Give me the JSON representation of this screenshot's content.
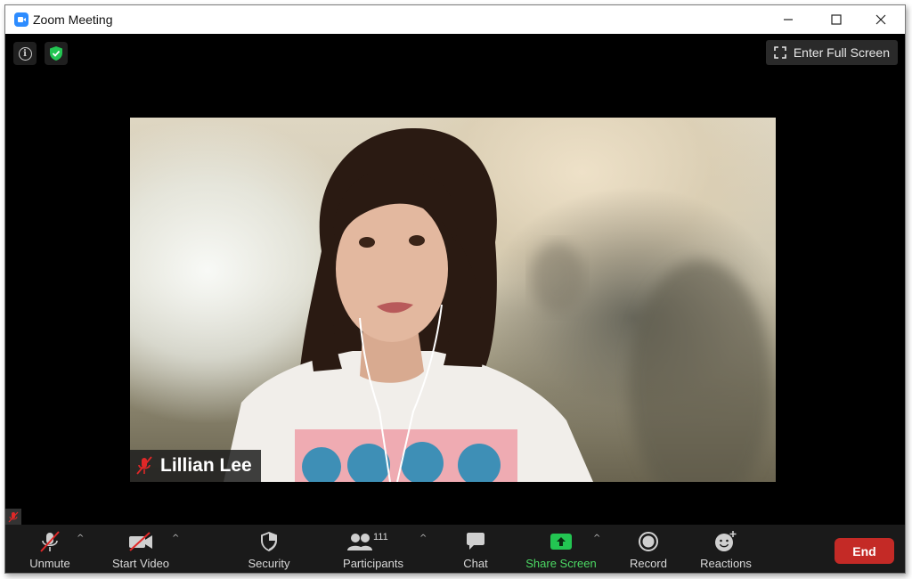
{
  "window": {
    "title": "Zoom Meeting",
    "minimize_glyph": "—",
    "maximize_glyph": "☐",
    "close_glyph": "✕"
  },
  "top": {
    "fullscreen_label": "Enter Full Screen",
    "info_icon": "info-icon",
    "security_icon": "shield-check-icon"
  },
  "video": {
    "participant_name": "Lillian Lee",
    "muted_icon": "mic-muted-icon"
  },
  "toolbar": {
    "unmute_label": "Unmute",
    "start_video_label": "Start Video",
    "security_label": "Security",
    "participants_label": "Participants",
    "participants_count": "111",
    "chat_label": "Chat",
    "share_screen_label": "Share Screen",
    "record_label": "Record",
    "reactions_label": "Reactions",
    "end_label": "End",
    "caret_glyph": "^"
  },
  "colors": {
    "zoom_blue": "#2d8cff",
    "share_green": "#4cd964",
    "end_red": "#c42a26",
    "muted_red": "#e02828",
    "security_green": "#23c552"
  }
}
